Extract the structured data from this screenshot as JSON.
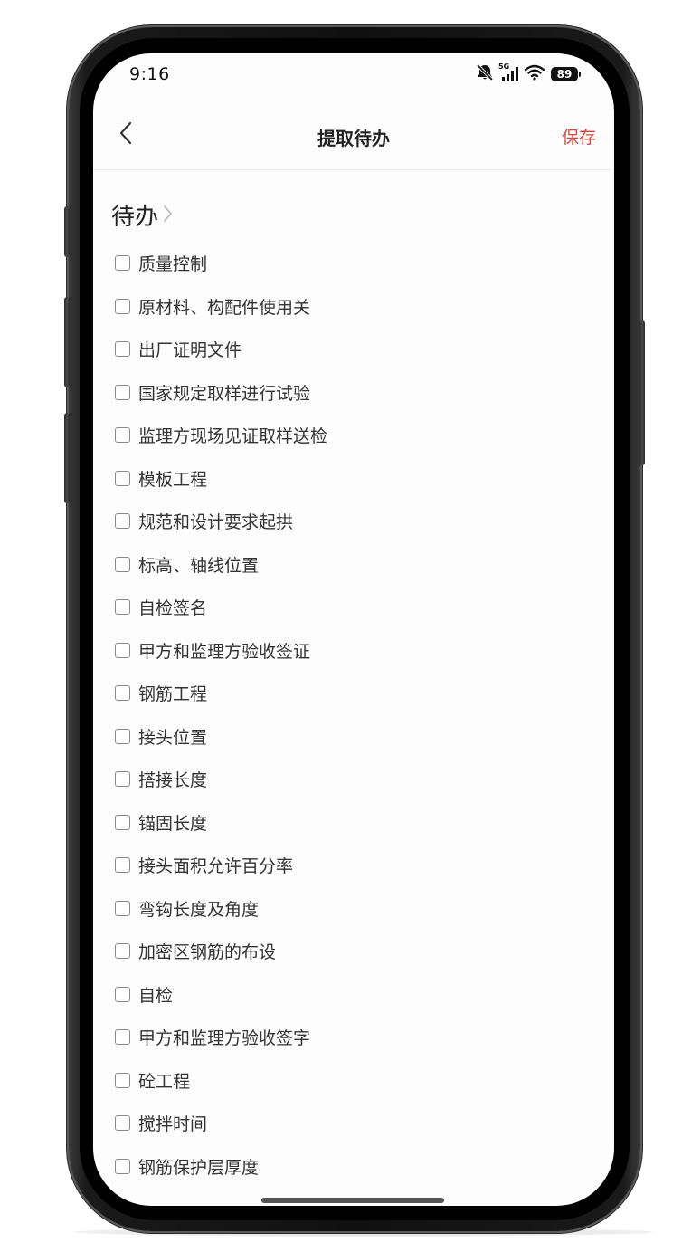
{
  "status_bar": {
    "time": "9:16",
    "network": "5G",
    "battery": "89"
  },
  "nav": {
    "title": "提取待办",
    "save_label": "保存"
  },
  "section": {
    "title": "待办"
  },
  "todo_items": [
    {
      "label": "质量控制",
      "checked": false
    },
    {
      "label": "原材料、构配件使用关",
      "checked": false
    },
    {
      "label": "出厂证明文件",
      "checked": false
    },
    {
      "label": "国家规定取样进行试验",
      "checked": false
    },
    {
      "label": "监理方现场见证取样送检",
      "checked": false
    },
    {
      "label": "模板工程",
      "checked": false
    },
    {
      "label": "规范和设计要求起拱",
      "checked": false
    },
    {
      "label": "标高、轴线位置",
      "checked": false
    },
    {
      "label": "自检签名",
      "checked": false
    },
    {
      "label": "甲方和监理方验收签证",
      "checked": false
    },
    {
      "label": "钢筋工程",
      "checked": false
    },
    {
      "label": "接头位置",
      "checked": false
    },
    {
      "label": "搭接长度",
      "checked": false
    },
    {
      "label": "锚固长度",
      "checked": false
    },
    {
      "label": "接头面积允许百分率",
      "checked": false
    },
    {
      "label": "弯钩长度及角度",
      "checked": false
    },
    {
      "label": "加密区钢筋的布设",
      "checked": false
    },
    {
      "label": "自检",
      "checked": false
    },
    {
      "label": "甲方和监理方验收签字",
      "checked": false
    },
    {
      "label": "砼工程",
      "checked": false
    },
    {
      "label": "搅拌时间",
      "checked": false
    },
    {
      "label": "钢筋保护层厚度",
      "checked": false
    }
  ],
  "colors": {
    "accent": "#d9473b",
    "text": "#333333",
    "background": "#fdfdfd"
  }
}
